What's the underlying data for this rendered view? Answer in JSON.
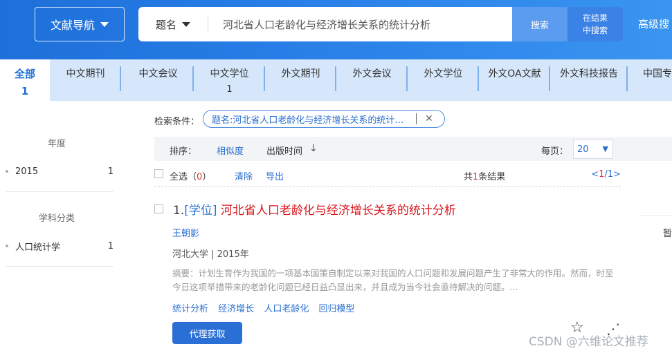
{
  "header": {
    "nav_label": "文献导航",
    "field_label": "题名",
    "search_value": "河北省人口老龄化与经济增长关系的统计分析",
    "search_button": "搜索",
    "in_result_line1": "在结果",
    "in_result_line2": "中搜索",
    "advanced": "高级搜"
  },
  "tabs": [
    {
      "label": "全部",
      "count": "1"
    },
    {
      "label": "中文期刊",
      "count": ""
    },
    {
      "label": "中文会议",
      "count": ""
    },
    {
      "label": "中文学位",
      "count": "1"
    },
    {
      "label": "外文期刊",
      "count": ""
    },
    {
      "label": "外文会议",
      "count": ""
    },
    {
      "label": "外文学位",
      "count": ""
    },
    {
      "label": "外文OA文献",
      "count": ""
    },
    {
      "label": "外文科技报告",
      "count": ""
    },
    {
      "label": "中国专",
      "count": ""
    }
  ],
  "sidebar": {
    "year_heading": "年度",
    "years": [
      {
        "label": "2015",
        "count": "1"
      }
    ],
    "subject_heading": "学科分类",
    "subjects": [
      {
        "label": "人口统计学",
        "count": "1"
      }
    ]
  },
  "filter": {
    "label": "检索条件：",
    "tag": "题名:河北省人口老龄化与经济增长关系的统计分析"
  },
  "sort": {
    "label": "排序：",
    "relevance": "相似度",
    "date": "出版时间",
    "per_page_label": "每页：",
    "per_page_value": "20"
  },
  "selection": {
    "select_all": "全选",
    "selected_count": "0",
    "clear": "清除",
    "export": "导出",
    "total_prefix": "共",
    "total_count": "1",
    "total_suffix": "条结果",
    "page_current": "1",
    "page_total": "1"
  },
  "result": {
    "index": "1.",
    "type": "[学位]",
    "title": "河北省人口老龄化与经济增长关系的统计分析",
    "author": "王朝影",
    "source": "河北大学 | 2015年",
    "abstract": "摘要：计划生育作为我国的一项基本国策自制定以来对我国的人口问题和发展问题产生了非常大的作用。然而，时至今日这项举措带来的老龄化问题已经日益凸显出来，并且成为当今社会亟待解决的问题。...",
    "keywords": [
      "统计分析",
      "经济增长",
      "人口老龄化",
      "回归模型"
    ],
    "proxy_button": "代理获取"
  },
  "right_fragment": "暂",
  "watermark": "CSDN @六维论文推荐",
  "colors": {
    "header_blue": "#2b83ea",
    "link_blue": "#2a6fd1",
    "title_red": "#d9161c",
    "tab_bg": "#d6e7fb"
  }
}
